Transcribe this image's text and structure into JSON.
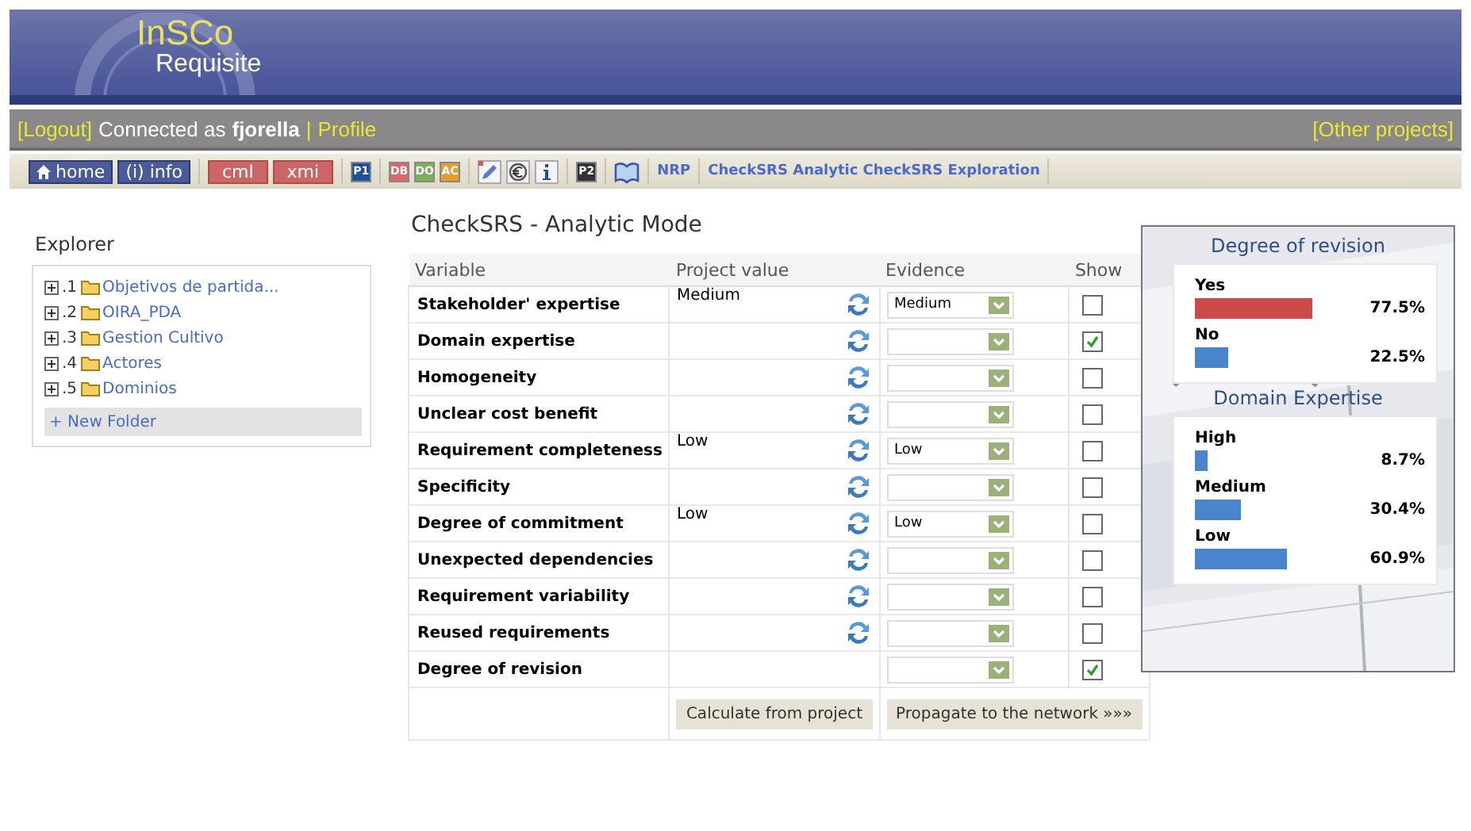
{
  "header": {
    "logo_top": "InSCo",
    "logo_bottom": "Requisite"
  },
  "userbar": {
    "logout": "[Logout]",
    "connected": "Connected as",
    "user": "fjorella",
    "separator": "|",
    "profile": "Profile",
    "other": "[Other projects]"
  },
  "toolbar": [
    [
      {
        "kind": "home",
        "label": "home"
      },
      {
        "kind": "nav",
        "label": "(i) info"
      }
    ],
    [
      {
        "kind": "tag",
        "label": "cml"
      },
      {
        "kind": "tag",
        "label": "xmi"
      }
    ],
    [
      {
        "kind": "square",
        "label": "P1",
        "color": "#1f4f9a"
      }
    ],
    [
      {
        "kind": "square",
        "label": "DB",
        "color": "#d9686a"
      },
      {
        "kind": "square",
        "label": "DO",
        "color": "#7fae5a"
      },
      {
        "kind": "square",
        "label": "AC",
        "color": "#e0a030"
      }
    ],
    [
      {
        "kind": "pencil"
      },
      {
        "kind": "euro"
      },
      {
        "kind": "info"
      }
    ],
    [
      {
        "kind": "square",
        "label": "P2",
        "color": "#333333"
      }
    ],
    [
      {
        "kind": "book"
      }
    ],
    [
      {
        "kind": "link",
        "label": "NRP"
      }
    ],
    [
      {
        "kind": "link",
        "label": "CheckSRS Analytic"
      },
      {
        "kind": "link",
        "label": "CheckSRS Exploration"
      }
    ]
  ],
  "explorer": {
    "title": "Explorer",
    "items": [
      {
        "number": ".1",
        "label": "Objetivos de partida..."
      },
      {
        "number": ".2",
        "label": "OIRA_PDA"
      },
      {
        "number": ".3",
        "label": "Gestion Cultivo"
      },
      {
        "number": ".4",
        "label": "Actores"
      },
      {
        "number": ".5",
        "label": "Dominios"
      }
    ],
    "new_folder": "+ New Folder"
  },
  "main": {
    "title": "CheckSRS - Analytic Mode",
    "columns": [
      "Variable",
      "Project value",
      "Evidence",
      "Show"
    ],
    "rows": [
      {
        "variable": "Stakeholder' expertise",
        "project_value": "Medium",
        "refresh": true,
        "evidence": "Medium",
        "checked": false
      },
      {
        "variable": "Domain expertise",
        "refresh": true,
        "checked": true
      },
      {
        "variable": "Homogeneity",
        "refresh": true,
        "checked": false
      },
      {
        "variable": "Unclear cost benefit",
        "refresh": true,
        "checked": false
      },
      {
        "variable": "Requirement completeness",
        "project_value": "Low",
        "refresh": true,
        "evidence": "Low",
        "checked": false
      },
      {
        "variable": "Specificity",
        "refresh": true,
        "checked": false
      },
      {
        "variable": "Degree of commitment",
        "project_value": "Low",
        "refresh": true,
        "evidence": "Low",
        "checked": false
      },
      {
        "variable": "Unexpected dependencies",
        "refresh": true,
        "checked": false
      },
      {
        "variable": "Requirement variability",
        "refresh": true,
        "checked": false
      },
      {
        "variable": "Reused requirements",
        "refresh": true,
        "checked": false
      },
      {
        "variable": "Degree of revision",
        "refresh": false,
        "checked": true
      }
    ],
    "buttons": [
      "Calculate from project",
      "Propagate to the network »»»"
    ]
  },
  "results": [
    {
      "title": "Degree of revision",
      "items": [
        {
          "label": "Yes",
          "value": "77.5%",
          "color": "#cc4a4a"
        },
        {
          "label": "No",
          "value": "22.5%",
          "color": "#4a84cc"
        }
      ]
    },
    {
      "title": "Domain Expertise",
      "items": [
        {
          "label": "High",
          "value": "8.7%",
          "color": "#4a84cc"
        },
        {
          "label": "Medium",
          "value": "30.4%",
          "color": "#4a84cc"
        },
        {
          "label": "Low",
          "value": "60.9%",
          "color": "#4a84cc"
        }
      ]
    }
  ]
}
